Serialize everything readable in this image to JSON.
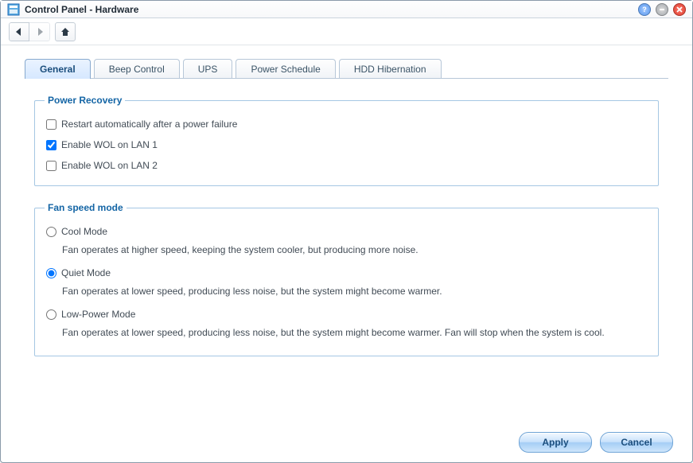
{
  "window": {
    "title": "Control Panel - Hardware"
  },
  "tabs": [
    {
      "label": "General",
      "active": true
    },
    {
      "label": "Beep Control",
      "active": false
    },
    {
      "label": "UPS",
      "active": false
    },
    {
      "label": "Power Schedule",
      "active": false
    },
    {
      "label": "HDD Hibernation",
      "active": false
    }
  ],
  "power_recovery": {
    "legend": "Power Recovery",
    "items": [
      {
        "label": "Restart automatically after a power failure",
        "checked": false
      },
      {
        "label": "Enable WOL on LAN 1",
        "checked": true
      },
      {
        "label": "Enable WOL on LAN 2",
        "checked": false
      }
    ]
  },
  "fan_speed": {
    "legend": "Fan speed mode",
    "modes": [
      {
        "label": "Cool Mode",
        "desc": "Fan operates at higher speed, keeping the system cooler, but producing more noise.",
        "selected": false
      },
      {
        "label": "Quiet Mode",
        "desc": "Fan operates at lower speed, producing less noise, but the system might become warmer.",
        "selected": true
      },
      {
        "label": "Low-Power Mode",
        "desc": "Fan operates at lower speed, producing less noise, but the system might become warmer. Fan will stop when the system is cool.",
        "selected": false
      }
    ]
  },
  "buttons": {
    "apply": "Apply",
    "cancel": "Cancel"
  }
}
